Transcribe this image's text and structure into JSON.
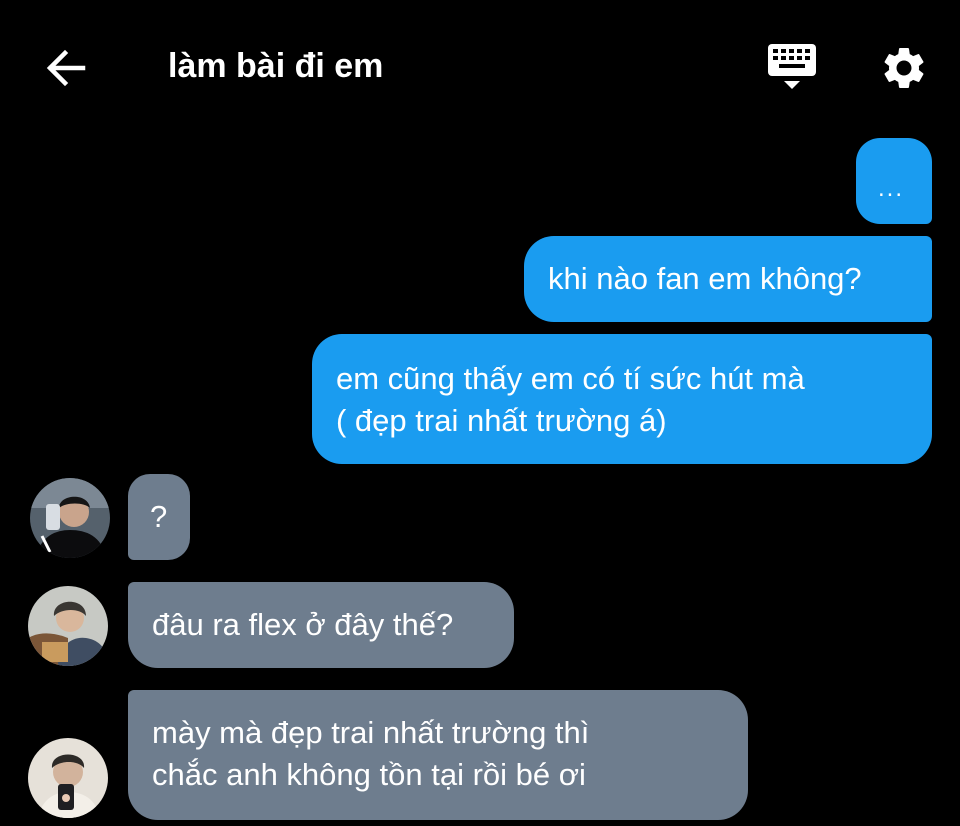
{
  "header": {
    "title": "làm bài đi em",
    "back_icon": "arrow-left-icon",
    "keyboard_icon": "keyboard-icon",
    "settings_icon": "gear-icon"
  },
  "colors": {
    "background": "#000000",
    "sent_bubble": "#1a9cf0",
    "received_bubble": "#6e7d8e",
    "text": "#ffffff"
  },
  "messages": [
    {
      "direction": "sent",
      "lines": [
        "..."
      ]
    },
    {
      "direction": "sent",
      "lines": [
        "khi nào fan em không?"
      ]
    },
    {
      "direction": "sent",
      "lines": [
        "em cũng thấy em có tí sức hút mà",
        "( đẹp trai nhất trường á)"
      ]
    },
    {
      "direction": "received",
      "lines": [
        "?"
      ]
    },
    {
      "direction": "received",
      "lines": [
        "đâu ra flex ở đây thế?"
      ]
    },
    {
      "direction": "received",
      "lines": [
        "mày mà đẹp trai nhất trường thì",
        "chắc anh không tồn tại rồi bé ơi"
      ]
    }
  ]
}
